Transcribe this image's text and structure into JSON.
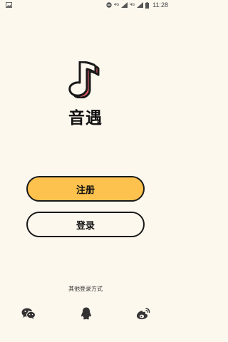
{
  "status_bar": {
    "time": "11:28",
    "network_1": "4G",
    "network_2": "4G",
    "network_2_label": "4G"
  },
  "app": {
    "name": "音遇"
  },
  "buttons": {
    "register_label": "注册",
    "login_label": "登录"
  },
  "social_login": {
    "label": "其他登录方式",
    "icons": [
      "wechat-icon",
      "qq-icon",
      "weibo-icon"
    ]
  },
  "colors": {
    "background": "#fdf8ee",
    "accent_yellow": "#fdc24d",
    "logo_pink": "#f2606c",
    "outline": "#1a1a1a"
  }
}
